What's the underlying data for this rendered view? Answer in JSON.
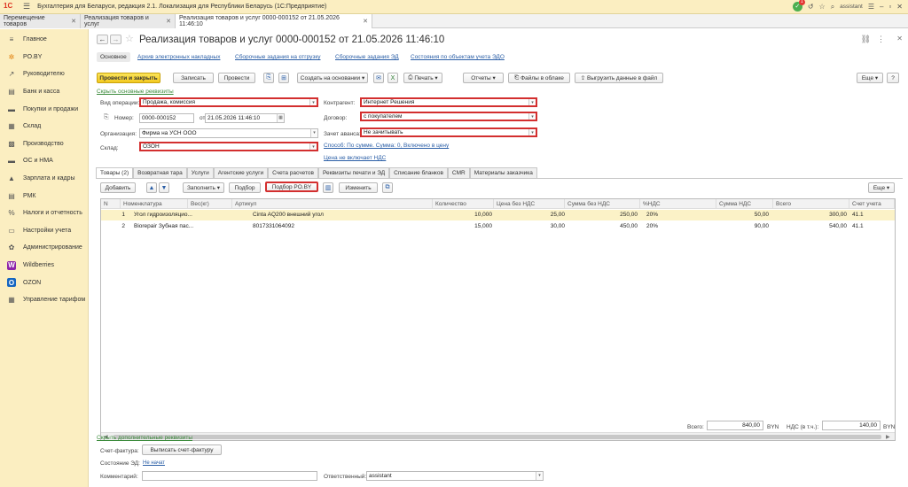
{
  "app": {
    "title": "Бухгалтерия для Беларуси, редакция 2.1. Локализация для Республики Беларусь (1С:Предприятие)",
    "user": "assistant",
    "notif_count": "1"
  },
  "open_tabs": [
    {
      "label": "Перемещение товаров"
    },
    {
      "label": "Реализация товаров и услуг"
    },
    {
      "label": "Реализация товаров и услуг 0000-000152 от 21.05.2026 11:46:10"
    }
  ],
  "sidebar": {
    "items": [
      {
        "label": "Главное",
        "icon": "≡"
      },
      {
        "label": "PO.BY",
        "icon": "✲"
      },
      {
        "label": "Руководителю",
        "icon": "↗"
      },
      {
        "label": "Банк и касса",
        "icon": "▤"
      },
      {
        "label": "Покупки и продажи",
        "icon": "▬"
      },
      {
        "label": "Склад",
        "icon": "▦"
      },
      {
        "label": "Производство",
        "icon": "▩"
      },
      {
        "label": "ОС и НМА",
        "icon": "▬"
      },
      {
        "label": "Зарплата и кадры",
        "icon": "▲"
      },
      {
        "label": "РМК",
        "icon": "▤"
      },
      {
        "label": "Налоги и отчетность",
        "icon": "%"
      },
      {
        "label": "Настройки учета",
        "icon": "▭"
      },
      {
        "label": "Администрирование",
        "icon": "✿"
      },
      {
        "label": "Wildberries",
        "icon": "W"
      },
      {
        "label": "OZON",
        "icon": "O"
      },
      {
        "label": "Управление тарифом",
        "icon": "▦"
      }
    ]
  },
  "doc": {
    "title": "Реализация товаров и услуг 0000-000152 от 21.05.2026 11:46:10",
    "subtabs": [
      "Основное",
      "Архив электронных накладных",
      "Сборочные задания на отгрузку",
      "Сборочные задания ЭД",
      "Состояния по объектам учета ЭДО"
    ],
    "toolbar": {
      "post_close": "Провести и закрыть",
      "save": "Записать",
      "post": "Провести",
      "create_based": "Создать на основании",
      "print": "Печать",
      "reports": "Отчеты",
      "cloud_files": "Файлы в облаке",
      "export": "Выгрузить данные в файл",
      "more": "Еще",
      "help": "?"
    },
    "hide_main": "Скрыть основные реквизиты",
    "fields": {
      "op_type_label": "Вид операции:",
      "op_type": "Продажа, комиссия",
      "number_label": "Номер:",
      "number": "0000-000152",
      "date_label": "от:",
      "date": "21.05.2026 11:46:10",
      "org_label": "Организация:",
      "org": "Фирма на УСН ООО",
      "warehouse_label": "Склад:",
      "warehouse": "ОЗОН",
      "contractor_label": "Контрагент:",
      "contractor": "Интернет Решения",
      "contract_label": "Договор:",
      "contract": "с покупателем",
      "advance_label": "Зачет аванса:",
      "advance": "Не зачитывать",
      "method_link": "Способ: По сумме. Сумма: 0, Включено в цену",
      "vat_link": "Цена не включает НДС"
    },
    "inner_tabs": [
      "Товары (2)",
      "Возвратная тара",
      "Услуги",
      "Агентские услуги",
      "Счета расчетов",
      "Реквизиты печати и ЭД",
      "Списание бланков",
      "CMR",
      "Материалы заказчика"
    ],
    "table_toolbar": {
      "add": "Добавить",
      "fill": "Заполнить",
      "pick": "Подбор",
      "pick_po": "Подбор PO.BY",
      "change": "Изменить",
      "more": "Еще"
    },
    "table": {
      "headers": [
        "N",
        "Номенклатура",
        "Вес(кг)",
        "Артикул",
        "Количество",
        "Цена без НДС",
        "Сумма без НДС",
        "%НДС",
        "Сумма НДС",
        "Всего",
        "Счет учета"
      ],
      "rows": [
        [
          "1",
          "Угол гидроизоляцио...",
          "",
          "Cinta AQ200 внешний угол",
          "10,000",
          "25,00",
          "250,00",
          "20%",
          "50,00",
          "300,00",
          "41.1"
        ],
        [
          "2",
          "Biorepair Зубная пас...",
          "",
          "8017331064092",
          "15,000",
          "30,00",
          "450,00",
          "20%",
          "90,00",
          "540,00",
          "41.1"
        ]
      ]
    },
    "totals": {
      "total_label": "Всего:",
      "total": "840,00",
      "currency": "BYN",
      "vat_label": "НДС (в т.ч.):",
      "vat": "140,00",
      "currency2": "BYN"
    },
    "footer": {
      "hide_extra": "Скрыть дополнительные реквизиты",
      "invoice_label": "Счет-фактура:",
      "invoice_btn": "Выписать счет-фактуру",
      "ed_label": "Состояние ЭД:",
      "ed_value": "Не начат",
      "comment_label": "Комментарий:",
      "comment": "",
      "resp_label": "Ответственный:",
      "resp": "assistant"
    }
  },
  "colors": {
    "sidebar_bg": "#fbeec1",
    "accent_red": "#d32f2f",
    "button_yellow": "#f3c91f",
    "link_blue": "#2a5ea6",
    "selected_row": "#fbf2c7"
  }
}
